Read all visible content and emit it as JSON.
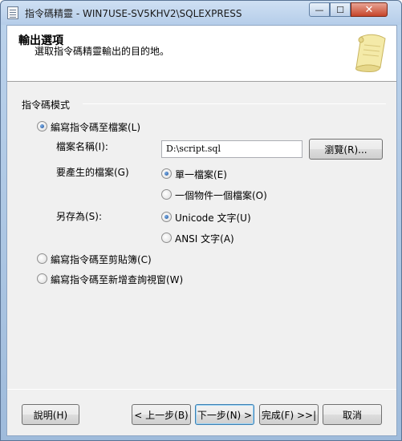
{
  "window": {
    "title": "指令碼精靈 - WIN7USE-SV5KHV2\\SQLEXPRESS",
    "min_glyph": "—",
    "max_glyph": "☐",
    "close_glyph": "✕"
  },
  "header": {
    "title": "輸出選項",
    "description": "選取指令碼精靈輸出的目的地。"
  },
  "group": {
    "label": "指令碼模式"
  },
  "options": {
    "script_to_file": {
      "label": "編寫指令碼至檔案(L)",
      "selected": true
    },
    "file_name_label": "檔案名稱(I):",
    "file_name_value": "D:\\script.sql",
    "browse_label": "瀏覽(R)...",
    "files_to_generate_label": "要產生的檔案(G)",
    "single_file": {
      "label": "單一檔案(E)",
      "selected": true
    },
    "one_file_per_object": {
      "label": "一個物件一個檔案(O)",
      "selected": false
    },
    "save_as_label": "另存為(S):",
    "unicode_text": {
      "label": "Unicode 文字(U)",
      "selected": true
    },
    "ansi_text": {
      "label": "ANSI 文字(A)",
      "selected": false
    },
    "script_to_clipboard": {
      "label": "編寫指令碼至剪貼簿(C)",
      "selected": false
    },
    "script_to_new_query": {
      "label": "編寫指令碼至新增查詢視窗(W)",
      "selected": false
    }
  },
  "footer": {
    "help": "說明(H)",
    "previous": "< 上一步(B)",
    "next": "下一步(N) >",
    "finish": "完成(F) >>|",
    "cancel": "取消"
  },
  "colors": {
    "titlebar": "#b5cde9",
    "client_bg": "#f0f0f0",
    "radio_selected": "#1b4f9a",
    "close_button": "#c6452a"
  }
}
